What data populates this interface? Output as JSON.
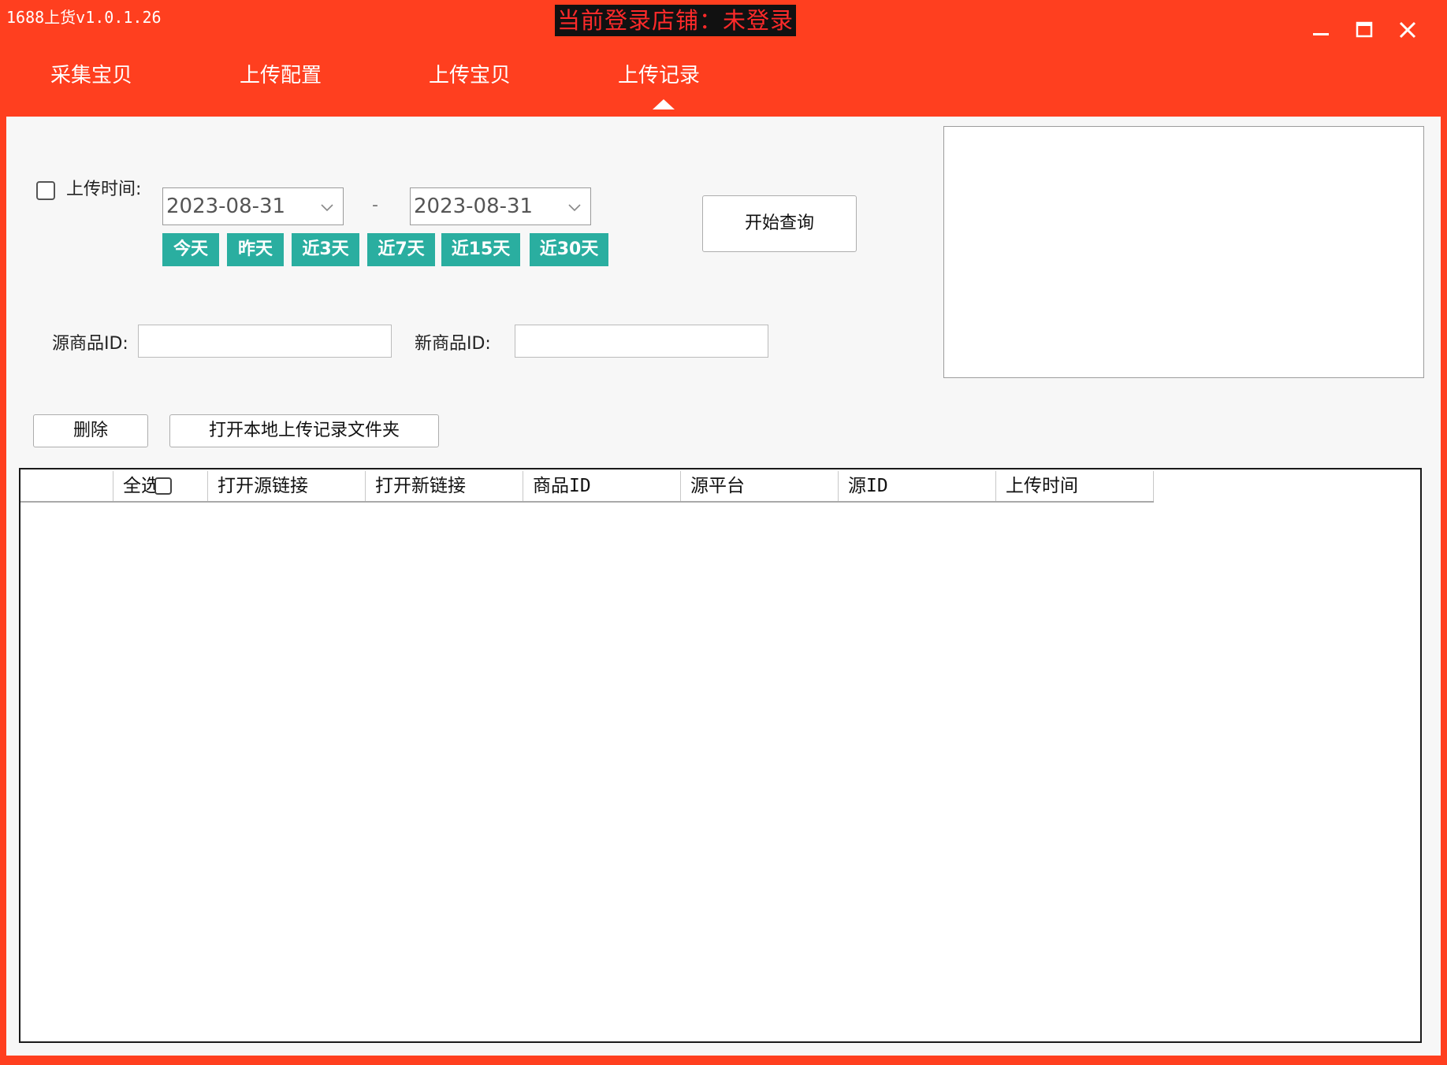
{
  "window": {
    "title": "1688上货v1.0.1.26",
    "store_status": "当前登录店铺：未登录",
    "controls": [
      "minimize-icon",
      "maximize-icon",
      "close-icon"
    ]
  },
  "tabs": [
    {
      "label": "采集宝贝"
    },
    {
      "label": "上传配置"
    },
    {
      "label": "上传宝贝"
    },
    {
      "label": "上传记录",
      "active": true
    }
  ],
  "filter": {
    "upload_time_label": "上传时间:",
    "start_date": "2023-08-31",
    "end_date": "2023-08-31",
    "separator": "-",
    "quick_ranges": [
      "今天",
      "昨天",
      "近3天",
      "近7天",
      "近15天",
      "近30天"
    ],
    "search_button": "开始查询",
    "source_id_label": "源商品ID:",
    "source_id_value": "",
    "new_id_label": "新商品ID:",
    "new_id_value": ""
  },
  "actions": {
    "delete": "删除",
    "open_folder": "打开本地上传记录文件夹"
  },
  "table": {
    "columns": [
      "",
      "全选",
      "打开源链接",
      "打开新链接",
      "商品ID",
      "源平台",
      "源ID",
      "上传时间"
    ],
    "rows": []
  },
  "colors": {
    "brand": "#ff3f1f",
    "quick_button": "#2aaea0",
    "status_text": "#ff2a2a"
  }
}
